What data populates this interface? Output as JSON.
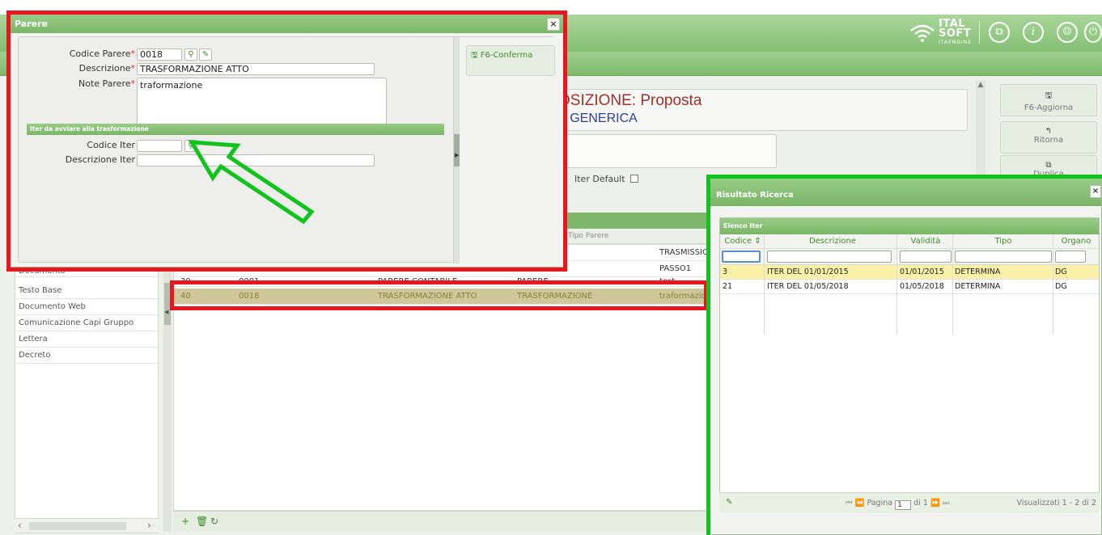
{
  "header": {
    "brand_line1": "ITAL",
    "brand_line2": "SOFT",
    "brand_line3": "ITAENGINE",
    "icons": [
      "window-icon",
      "info-icon",
      "user-icon",
      "power-icon"
    ]
  },
  "background": {
    "title_main": "OSIZIONE: Proposta",
    "title_sub": "A GENERICA",
    "iter_default_label": "Iter Default",
    "side_buttons": [
      {
        "icon": "save-icon",
        "label": "F6-Aggiorna"
      },
      {
        "icon": "back-icon",
        "label": "Ritorna"
      },
      {
        "icon": "copy-icon",
        "label": "Duplica"
      }
    ],
    "grid_subheader": "Tipo Parere",
    "grid_rows": [
      {
        "c1": "",
        "c2": "",
        "c3": "",
        "c4": "",
        "c5": "TRASMISSIONE"
      },
      {
        "c1": "",
        "c2": "",
        "c3": "",
        "c4": "",
        "c5": "PASSO1"
      },
      {
        "c1": "30",
        "c2": "0001",
        "c3": "PARERE CONTABILE",
        "c4": "PARERE",
        "c5": "test"
      },
      {
        "c1": "40",
        "c2": "0018",
        "c3": "TRASFORMAZIONE ATTO",
        "c4": "TRASFORMAZIONE",
        "c5": "traformazione"
      }
    ],
    "left_list": [
      "Documento",
      "Testo Base",
      "Documento Web",
      "Comunicazione Capi Gruppo",
      "Lettera",
      "Decreto"
    ],
    "footer_icons": [
      "+",
      "🗑",
      "↻"
    ]
  },
  "parere_dialog": {
    "title": "Parere",
    "close": "×",
    "codice_parere_label": "Codice Parere",
    "codice_parere_value": "0018",
    "descrizione_label": "Descrizione",
    "descrizione_value": "TRASFORMAZIONE ATTO",
    "note_label": "Note Parere",
    "note_value": "traformazione",
    "section_title": "Iter da avviare alla trasformazione",
    "codice_iter_label": "Codice Iter",
    "codice_iter_value": "",
    "descrizione_iter_label": "Descrizione Iter",
    "descrizione_iter_value": "",
    "confirm_label": "F6-Conferma",
    "required_mark": "*"
  },
  "ricerca_dialog": {
    "title": "Risultato Ricerca",
    "close": "×",
    "grid_caption": "Elenco Iter",
    "columns": [
      "Codice",
      "Descrizione",
      "Validità",
      "Tipo",
      "Organo"
    ],
    "rows": [
      {
        "codice": "3",
        "descrizione": "ITER DEL 01/01/2015",
        "validita": "01/01/2015",
        "tipo": "DETERMINA",
        "organo": "DG"
      },
      {
        "codice": "21",
        "descrizione": "ITER DEL 01/05/2018",
        "validita": "01/05/2018",
        "tipo": "DETERMINA",
        "organo": "DG"
      }
    ],
    "pager_prefix": "Pagina",
    "pager_page": "1",
    "pager_of": "di 1",
    "visualizzati": "Visualizzati 1 - 2 di 2"
  },
  "colors": {
    "accent_green": "#7ab567",
    "annotation_red": "#e8161f",
    "annotation_green": "#12c31d",
    "selected_row": "#fbf1a8"
  }
}
